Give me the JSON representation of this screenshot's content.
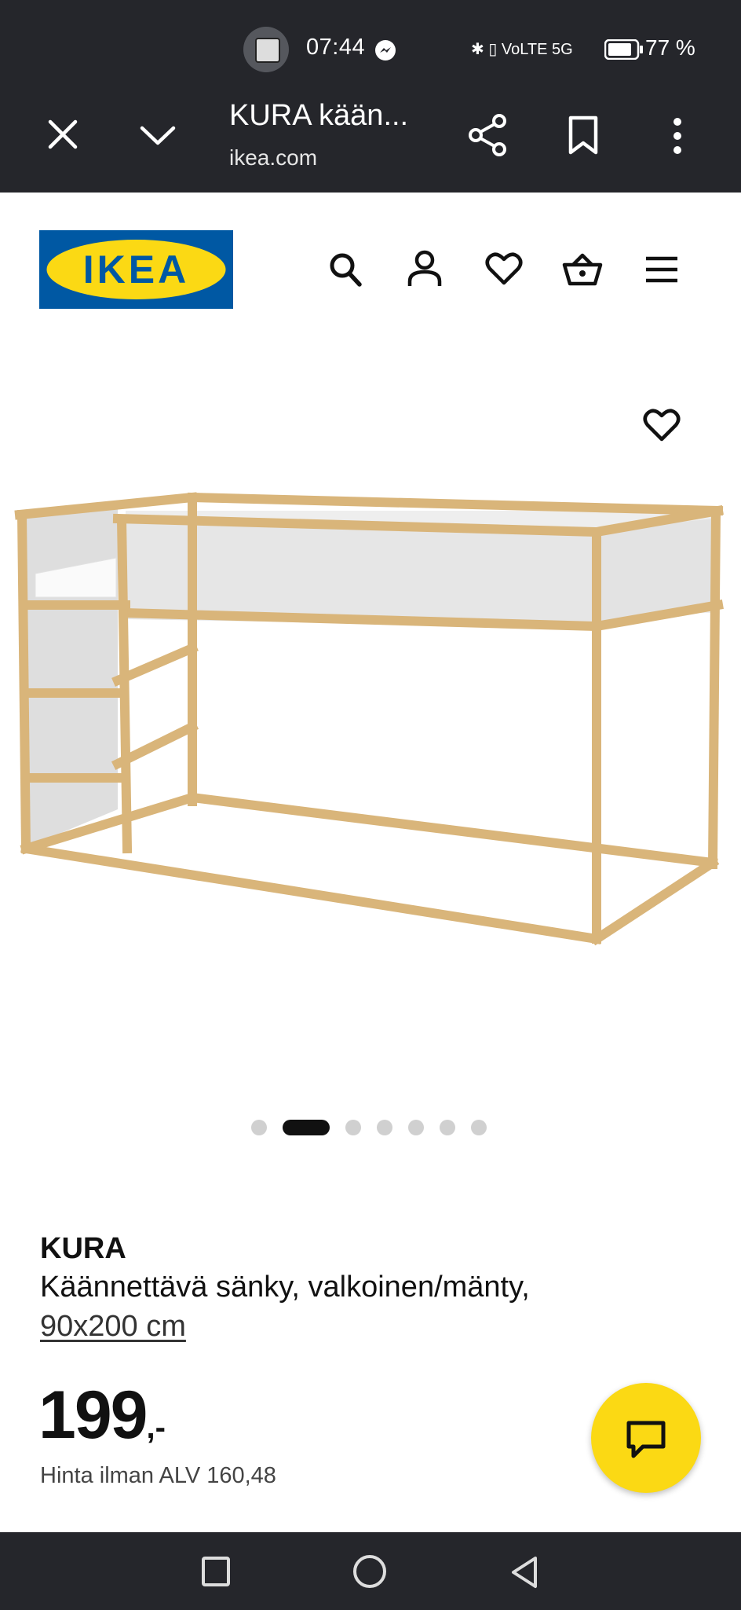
{
  "status_bar": {
    "time": "07:44",
    "network_icons": "✱ ▯ VoLTE 5G",
    "battery_percent": "77 %"
  },
  "browser": {
    "tab_title": "KURA kään...",
    "url": "ikea.com",
    "icons": [
      "close-icon",
      "chevron-down-icon",
      "share-icon",
      "bookmark-icon",
      "more-vert-icon"
    ]
  },
  "site_header": {
    "logo_text": "IKEA",
    "icons": [
      "search-icon",
      "account-icon",
      "heart-icon",
      "basket-icon",
      "menu-icon"
    ]
  },
  "gallery": {
    "total_images": 7,
    "active_index": 1
  },
  "product": {
    "name": "KURA",
    "description": "Käännettävä sänky, valkoinen/mänty,",
    "size": "90x200 cm",
    "price": "199",
    "price_suffix": ",-",
    "vat_text": "Hinta ilman ALV 160,48"
  },
  "colors": {
    "ikea_blue": "#0058a3",
    "ikea_yellow": "#fbd914",
    "dark_bar": "#25262b"
  }
}
